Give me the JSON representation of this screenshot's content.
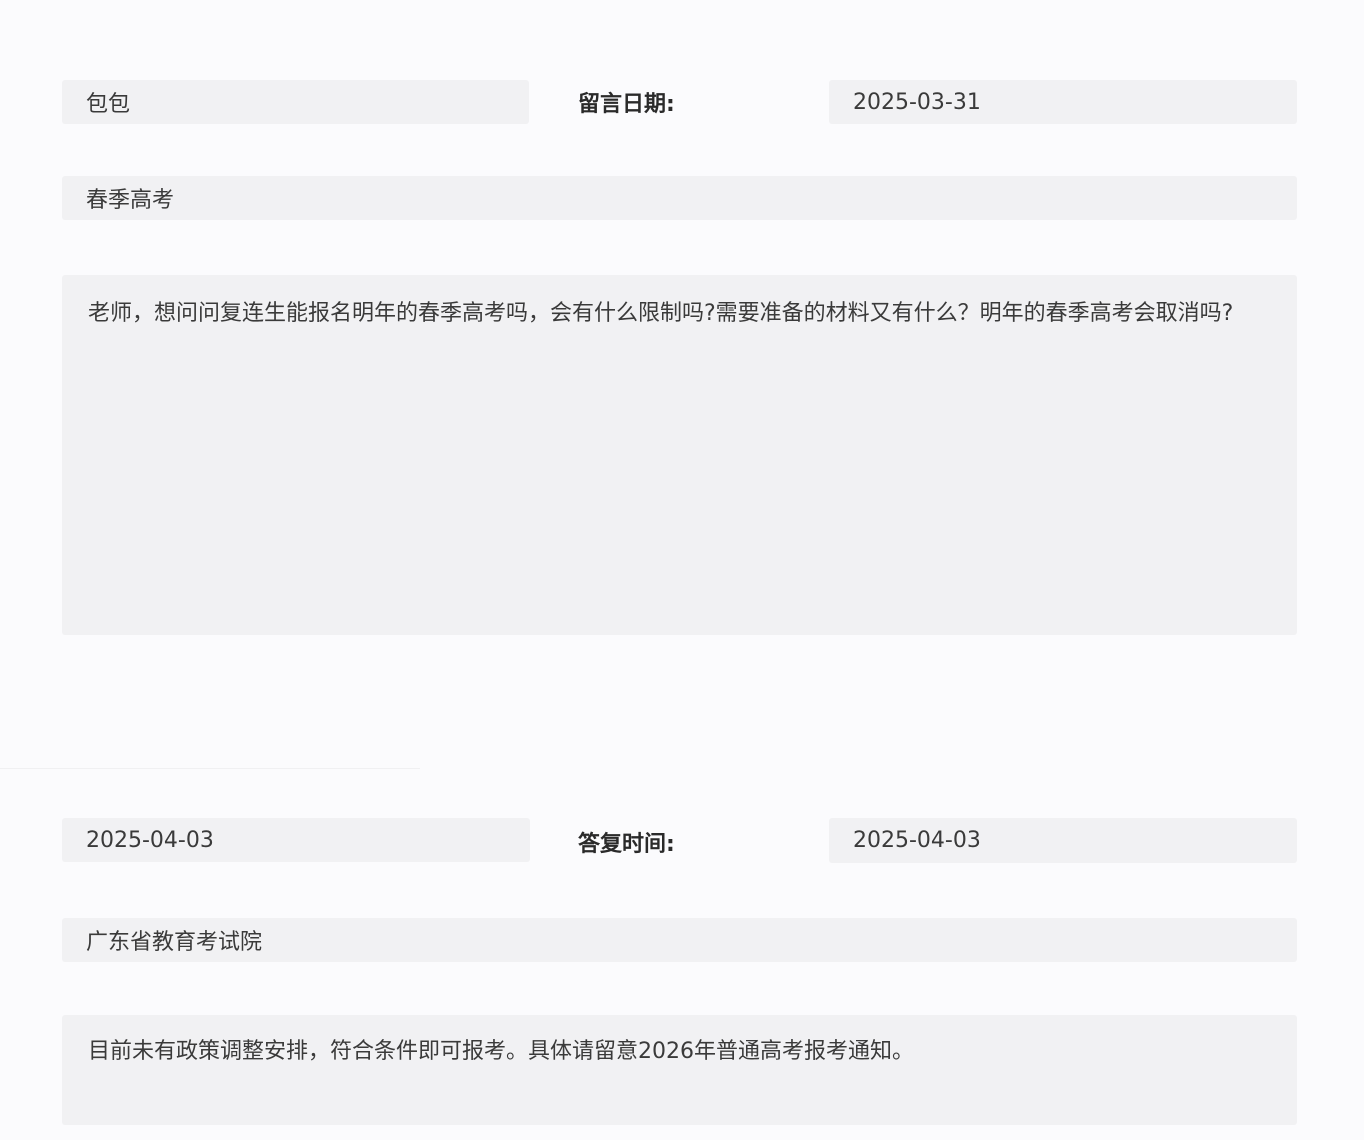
{
  "message": {
    "name_value": "包包",
    "date_label": "留言日期:",
    "date_value": "2025-03-31",
    "category_value": "春季高考",
    "content_value": "老师，想问问复连生能报名明年的春季高考吗，会有什么限制吗?需要准备的材料又有什么？明年的春季高考会取消吗?"
  },
  "reply": {
    "date_value": "2025-04-03",
    "time_label": "答复时间:",
    "time_value": "2025-04-03",
    "department_value": "广东省教育考试院",
    "content_value": "目前未有政策调整安排，符合条件即可报考。具体请留意2026年普通高考报考通知。"
  }
}
